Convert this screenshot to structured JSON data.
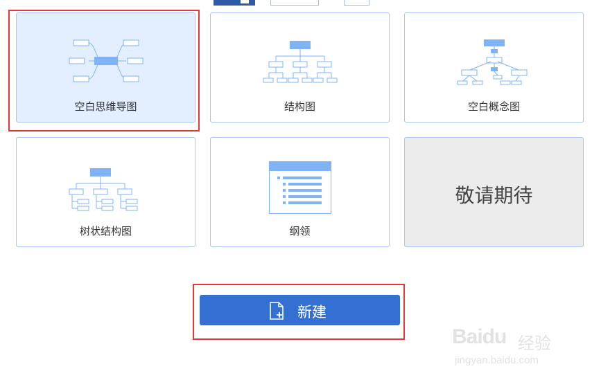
{
  "templates": [
    {
      "label": "空白思维导图",
      "state": "selected",
      "icon": "mindmap-icon"
    },
    {
      "label": "结构图",
      "state": "normal",
      "icon": "org-chart-icon"
    },
    {
      "label": "空白概念图",
      "state": "normal",
      "icon": "concept-map-icon"
    },
    {
      "label": "树状结构图",
      "state": "normal",
      "icon": "tree-chart-icon"
    },
    {
      "label": "纲领",
      "state": "normal",
      "icon": "outline-icon"
    },
    {
      "label": "敬请期待",
      "state": "disabled"
    }
  ],
  "create_button": {
    "label": "新建",
    "icon": "new-file-icon"
  },
  "watermark": {
    "text": "Baidu",
    "cn": "经验",
    "url": "jingyan.baidu.com"
  },
  "colors": {
    "accent": "#3370d2",
    "selected_bg": "#e3efff",
    "card_border": "#a8c6ef",
    "icon_blue": "#7fb3f5",
    "highlight_red": "#e53935"
  }
}
